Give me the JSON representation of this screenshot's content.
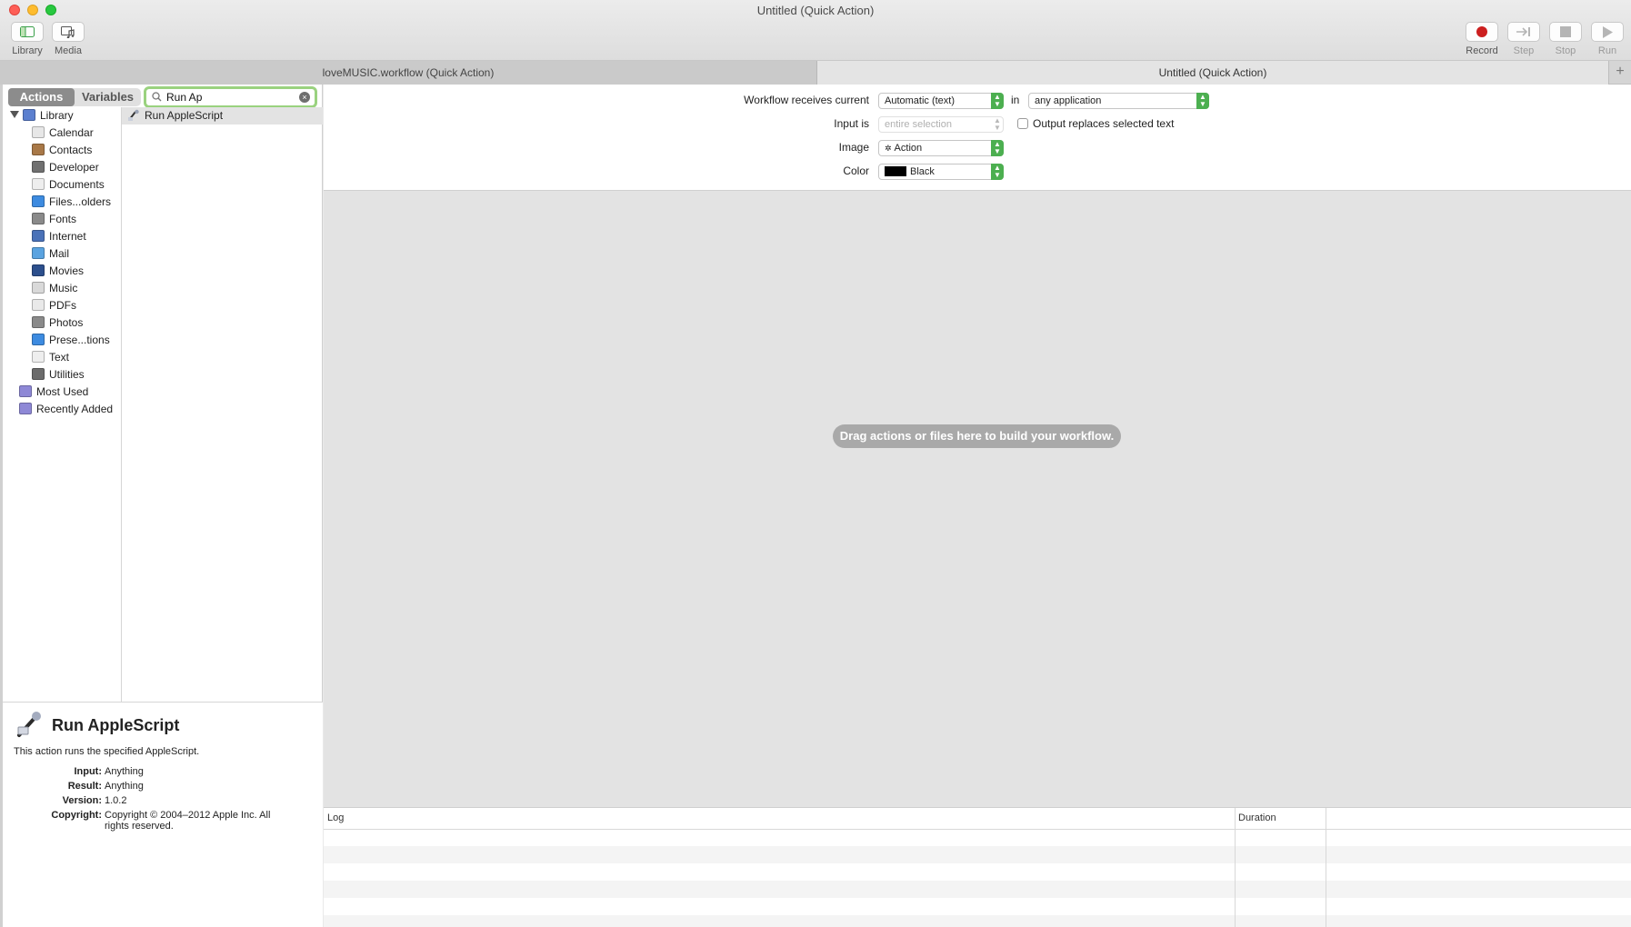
{
  "window": {
    "title": "Untitled (Quick Action)"
  },
  "toolbar": {
    "library_label": "Library",
    "media_label": "Media",
    "record_label": "Record",
    "step_label": "Step",
    "stop_label": "Stop",
    "run_label": "Run"
  },
  "tabs": [
    {
      "label": "loveMUSIC.workflow (Quick Action)",
      "active": false
    },
    {
      "label": "Untitled (Quick Action)",
      "active": true
    }
  ],
  "tab_add_label": "+",
  "left": {
    "segments": {
      "actions": "Actions",
      "variables": "Variables",
      "selected": "Actions"
    },
    "search": {
      "value": "Run Ap",
      "clear": "×"
    },
    "tree": {
      "root": "Library",
      "items": [
        {
          "label": "Calendar",
          "icon": "calendar-icon",
          "color": "#e7e7e7"
        },
        {
          "label": "Contacts",
          "icon": "contacts-icon",
          "color": "#a87847"
        },
        {
          "label": "Developer",
          "icon": "developer-icon",
          "color": "#707070"
        },
        {
          "label": "Documents",
          "icon": "documents-icon",
          "color": "#eeeeee"
        },
        {
          "label": "Files...olders",
          "icon": "finder-icon",
          "color": "#3d8be0"
        },
        {
          "label": "Fonts",
          "icon": "fonts-icon",
          "color": "#8a8a8a"
        },
        {
          "label": "Internet",
          "icon": "internet-icon",
          "color": "#4a72b8"
        },
        {
          "label": "Mail",
          "icon": "mail-icon",
          "color": "#5aa3e0"
        },
        {
          "label": "Movies",
          "icon": "movies-icon",
          "color": "#2c4f8c"
        },
        {
          "label": "Music",
          "icon": "music-icon",
          "color": "#d9d9d9"
        },
        {
          "label": "PDFs",
          "icon": "pdfs-icon",
          "color": "#e9e9e9"
        },
        {
          "label": "Photos",
          "icon": "photos-icon",
          "color": "#8a8a8a"
        },
        {
          "label": "Prese...tions",
          "icon": "presentations-icon",
          "color": "#3d8be0"
        },
        {
          "label": "Text",
          "icon": "text-icon",
          "color": "#eeeeee"
        },
        {
          "label": "Utilities",
          "icon": "utilities-icon",
          "color": "#6b6b6b"
        }
      ],
      "extras": [
        {
          "label": "Most Used",
          "icon": "smart-folder-icon",
          "color": "#8e88d6"
        },
        {
          "label": "Recently Added",
          "icon": "smart-folder-icon",
          "color": "#8e88d6"
        }
      ]
    },
    "results": [
      {
        "label": "Run AppleScript",
        "icon": "applescript-icon"
      }
    ],
    "description": {
      "title": "Run AppleScript",
      "text": "This action runs the specified AppleScript.",
      "input_key": "Input:",
      "input_val": "Anything",
      "result_key": "Result:",
      "result_val": "Anything",
      "version_key": "Version:",
      "version_val": "1.0.2",
      "copyright_key": "Copyright:",
      "copyright_val": "Copyright © 2004–2012 Apple Inc.  All rights reserved."
    }
  },
  "workflow_header": {
    "receives_label": "Workflow receives current",
    "receives_value": "Automatic (text)",
    "in_label": "in",
    "app_value": "any application",
    "input_is_label": "Input is",
    "input_is_value": "entire selection",
    "output_replaces_label": "Output replaces selected text",
    "output_replaces_checked": false,
    "image_label": "Image",
    "image_value": "Action",
    "color_label": "Color",
    "color_value": "Black",
    "color_swatch": "#000000"
  },
  "workarea": {
    "hint": "Drag actions or files here to build your workflow."
  },
  "log": {
    "log_header": "Log",
    "duration_header": "Duration"
  },
  "colors": {
    "accent_green": "#4caf50",
    "record_red": "#cc1f1f",
    "search_focus": "#9ad27f"
  }
}
